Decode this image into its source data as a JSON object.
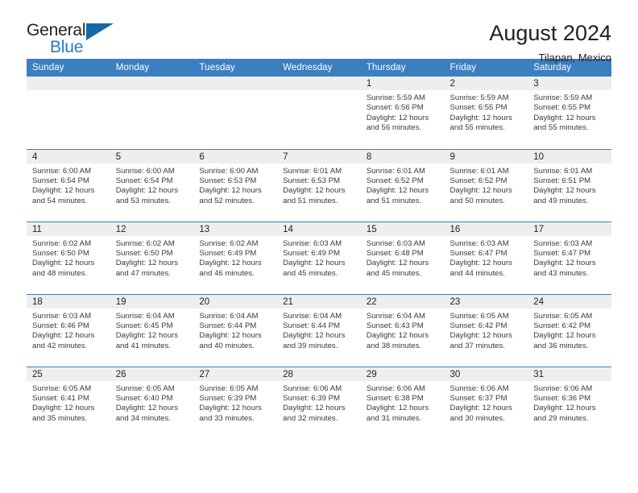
{
  "brand": {
    "name_top": "General",
    "name_bottom": "Blue",
    "triangle_icon": "blue-triangle-logo-mark",
    "color_dark": "#231f20",
    "color_blue": "#1f7ec4",
    "color_triangle": "#1668a8"
  },
  "header": {
    "title": "August 2024",
    "subtitle": "Tilapan, Mexico"
  },
  "theme": {
    "header_row_bg": "#3a7fc0",
    "header_row_text": "#ffffff",
    "daynum_band_bg": "#eeeeee",
    "row_separator": "#3a7fc0",
    "body_text": "#3a3a3a"
  },
  "calendar": {
    "day_headers": [
      "Sunday",
      "Monday",
      "Tuesday",
      "Wednesday",
      "Thursday",
      "Friday",
      "Saturday"
    ],
    "weeks": [
      [
        {
          "day": "",
          "sunrise": "",
          "sunset": "",
          "daylight_1": "",
          "daylight_2": ""
        },
        {
          "day": "",
          "sunrise": "",
          "sunset": "",
          "daylight_1": "",
          "daylight_2": ""
        },
        {
          "day": "",
          "sunrise": "",
          "sunset": "",
          "daylight_1": "",
          "daylight_2": ""
        },
        {
          "day": "",
          "sunrise": "",
          "sunset": "",
          "daylight_1": "",
          "daylight_2": ""
        },
        {
          "day": "1",
          "sunrise": "Sunrise: 5:59 AM",
          "sunset": "Sunset: 6:56 PM",
          "daylight_1": "Daylight: 12 hours",
          "daylight_2": "and 56 minutes."
        },
        {
          "day": "2",
          "sunrise": "Sunrise: 5:59 AM",
          "sunset": "Sunset: 6:55 PM",
          "daylight_1": "Daylight: 12 hours",
          "daylight_2": "and 55 minutes."
        },
        {
          "day": "3",
          "sunrise": "Sunrise: 5:59 AM",
          "sunset": "Sunset: 6:55 PM",
          "daylight_1": "Daylight: 12 hours",
          "daylight_2": "and 55 minutes."
        }
      ],
      [
        {
          "day": "4",
          "sunrise": "Sunrise: 6:00 AM",
          "sunset": "Sunset: 6:54 PM",
          "daylight_1": "Daylight: 12 hours",
          "daylight_2": "and 54 minutes."
        },
        {
          "day": "5",
          "sunrise": "Sunrise: 6:00 AM",
          "sunset": "Sunset: 6:54 PM",
          "daylight_1": "Daylight: 12 hours",
          "daylight_2": "and 53 minutes."
        },
        {
          "day": "6",
          "sunrise": "Sunrise: 6:00 AM",
          "sunset": "Sunset: 6:53 PM",
          "daylight_1": "Daylight: 12 hours",
          "daylight_2": "and 52 minutes."
        },
        {
          "day": "7",
          "sunrise": "Sunrise: 6:01 AM",
          "sunset": "Sunset: 6:53 PM",
          "daylight_1": "Daylight: 12 hours",
          "daylight_2": "and 51 minutes."
        },
        {
          "day": "8",
          "sunrise": "Sunrise: 6:01 AM",
          "sunset": "Sunset: 6:52 PM",
          "daylight_1": "Daylight: 12 hours",
          "daylight_2": "and 51 minutes."
        },
        {
          "day": "9",
          "sunrise": "Sunrise: 6:01 AM",
          "sunset": "Sunset: 6:52 PM",
          "daylight_1": "Daylight: 12 hours",
          "daylight_2": "and 50 minutes."
        },
        {
          "day": "10",
          "sunrise": "Sunrise: 6:01 AM",
          "sunset": "Sunset: 6:51 PM",
          "daylight_1": "Daylight: 12 hours",
          "daylight_2": "and 49 minutes."
        }
      ],
      [
        {
          "day": "11",
          "sunrise": "Sunrise: 6:02 AM",
          "sunset": "Sunset: 6:50 PM",
          "daylight_1": "Daylight: 12 hours",
          "daylight_2": "and 48 minutes."
        },
        {
          "day": "12",
          "sunrise": "Sunrise: 6:02 AM",
          "sunset": "Sunset: 6:50 PM",
          "daylight_1": "Daylight: 12 hours",
          "daylight_2": "and 47 minutes."
        },
        {
          "day": "13",
          "sunrise": "Sunrise: 6:02 AM",
          "sunset": "Sunset: 6:49 PM",
          "daylight_1": "Daylight: 12 hours",
          "daylight_2": "and 46 minutes."
        },
        {
          "day": "14",
          "sunrise": "Sunrise: 6:03 AM",
          "sunset": "Sunset: 6:49 PM",
          "daylight_1": "Daylight: 12 hours",
          "daylight_2": "and 45 minutes."
        },
        {
          "day": "15",
          "sunrise": "Sunrise: 6:03 AM",
          "sunset": "Sunset: 6:48 PM",
          "daylight_1": "Daylight: 12 hours",
          "daylight_2": "and 45 minutes."
        },
        {
          "day": "16",
          "sunrise": "Sunrise: 6:03 AM",
          "sunset": "Sunset: 6:47 PM",
          "daylight_1": "Daylight: 12 hours",
          "daylight_2": "and 44 minutes."
        },
        {
          "day": "17",
          "sunrise": "Sunrise: 6:03 AM",
          "sunset": "Sunset: 6:47 PM",
          "daylight_1": "Daylight: 12 hours",
          "daylight_2": "and 43 minutes."
        }
      ],
      [
        {
          "day": "18",
          "sunrise": "Sunrise: 6:03 AM",
          "sunset": "Sunset: 6:46 PM",
          "daylight_1": "Daylight: 12 hours",
          "daylight_2": "and 42 minutes."
        },
        {
          "day": "19",
          "sunrise": "Sunrise: 6:04 AM",
          "sunset": "Sunset: 6:45 PM",
          "daylight_1": "Daylight: 12 hours",
          "daylight_2": "and 41 minutes."
        },
        {
          "day": "20",
          "sunrise": "Sunrise: 6:04 AM",
          "sunset": "Sunset: 6:44 PM",
          "daylight_1": "Daylight: 12 hours",
          "daylight_2": "and 40 minutes."
        },
        {
          "day": "21",
          "sunrise": "Sunrise: 6:04 AM",
          "sunset": "Sunset: 6:44 PM",
          "daylight_1": "Daylight: 12 hours",
          "daylight_2": "and 39 minutes."
        },
        {
          "day": "22",
          "sunrise": "Sunrise: 6:04 AM",
          "sunset": "Sunset: 6:43 PM",
          "daylight_1": "Daylight: 12 hours",
          "daylight_2": "and 38 minutes."
        },
        {
          "day": "23",
          "sunrise": "Sunrise: 6:05 AM",
          "sunset": "Sunset: 6:42 PM",
          "daylight_1": "Daylight: 12 hours",
          "daylight_2": "and 37 minutes."
        },
        {
          "day": "24",
          "sunrise": "Sunrise: 6:05 AM",
          "sunset": "Sunset: 6:42 PM",
          "daylight_1": "Daylight: 12 hours",
          "daylight_2": "and 36 minutes."
        }
      ],
      [
        {
          "day": "25",
          "sunrise": "Sunrise: 6:05 AM",
          "sunset": "Sunset: 6:41 PM",
          "daylight_1": "Daylight: 12 hours",
          "daylight_2": "and 35 minutes."
        },
        {
          "day": "26",
          "sunrise": "Sunrise: 6:05 AM",
          "sunset": "Sunset: 6:40 PM",
          "daylight_1": "Daylight: 12 hours",
          "daylight_2": "and 34 minutes."
        },
        {
          "day": "27",
          "sunrise": "Sunrise: 6:05 AM",
          "sunset": "Sunset: 6:39 PM",
          "daylight_1": "Daylight: 12 hours",
          "daylight_2": "and 33 minutes."
        },
        {
          "day": "28",
          "sunrise": "Sunrise: 6:06 AM",
          "sunset": "Sunset: 6:39 PM",
          "daylight_1": "Daylight: 12 hours",
          "daylight_2": "and 32 minutes."
        },
        {
          "day": "29",
          "sunrise": "Sunrise: 6:06 AM",
          "sunset": "Sunset: 6:38 PM",
          "daylight_1": "Daylight: 12 hours",
          "daylight_2": "and 31 minutes."
        },
        {
          "day": "30",
          "sunrise": "Sunrise: 6:06 AM",
          "sunset": "Sunset: 6:37 PM",
          "daylight_1": "Daylight: 12 hours",
          "daylight_2": "and 30 minutes."
        },
        {
          "day": "31",
          "sunrise": "Sunrise: 6:06 AM",
          "sunset": "Sunset: 6:36 PM",
          "daylight_1": "Daylight: 12 hours",
          "daylight_2": "and 29 minutes."
        }
      ]
    ]
  }
}
